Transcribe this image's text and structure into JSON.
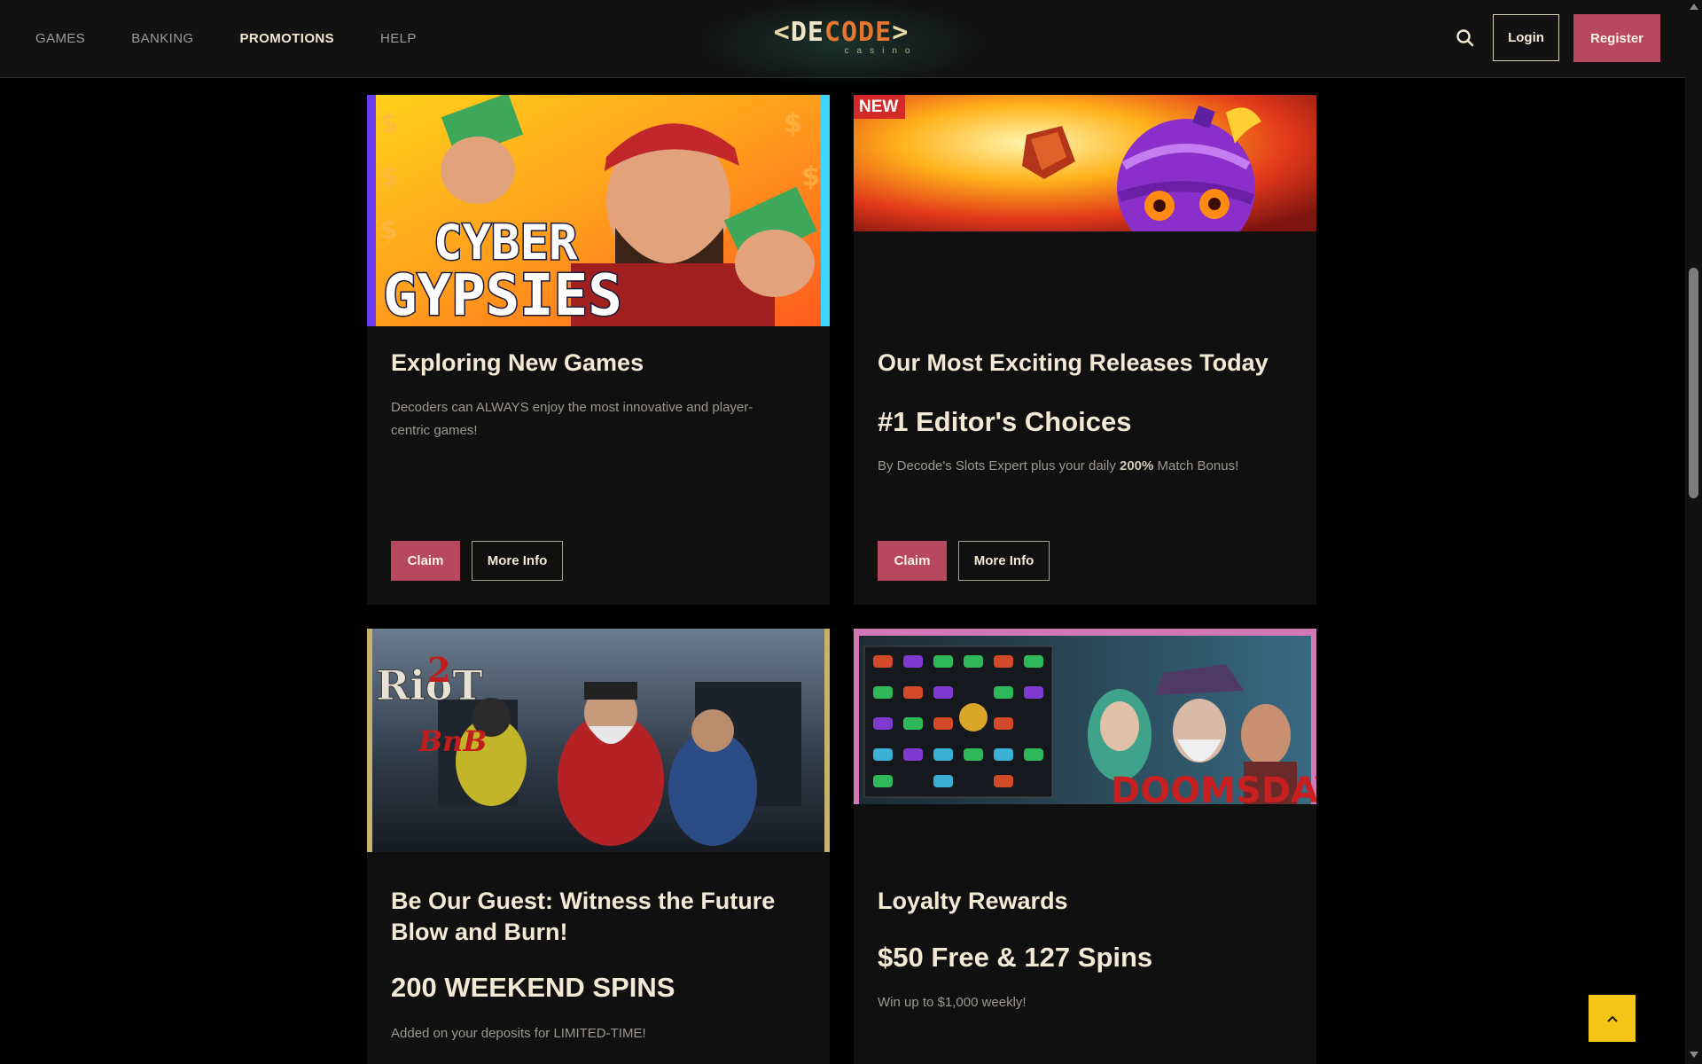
{
  "nav": {
    "items": [
      {
        "label": "GAMES",
        "active": false
      },
      {
        "label": "BANKING",
        "active": false
      },
      {
        "label": "PROMOTIONS",
        "active": true
      },
      {
        "label": "HELP",
        "active": false
      }
    ]
  },
  "logo": {
    "main": "DECODE",
    "sub": "casino"
  },
  "header": {
    "search_icon": "search-icon",
    "login_label": "Login",
    "register_label": "Register"
  },
  "cards": [
    {
      "image_text": "CYBER GYPSIES",
      "title": "Exploring New Games",
      "headline": "",
      "description": "Decoders can ALWAYS enjoy the most innovative and player-centric games!",
      "claim_label": "Claim",
      "more_label": "More Info"
    },
    {
      "badge": "NEW",
      "title": "Our Most Exciting Releases Today",
      "headline": "#1 Editor's Choices",
      "description_pre": "By Decode's Slots Expert plus your daily ",
      "description_bold": "200%",
      "description_post": " Match Bonus!",
      "claim_label": "Claim",
      "more_label": "More Info"
    },
    {
      "image_text": "Riot 2",
      "image_text_sub": "BnB",
      "title": "Be Our Guest: Witness the Future Blow and Burn!",
      "headline": "200 WEEKEND SPINS",
      "description": "Added on your deposits for LIMITED-TIME!"
    },
    {
      "image_text": "DOOMSDAY",
      "title": "Loyalty Rewards",
      "headline": "$50 Free & 127 Spins",
      "description": "Win up to $1,000 weekly!"
    }
  ],
  "colors": {
    "accent": "#b7485e",
    "background": "#000000",
    "card": "#101010",
    "back_to_top": "#f5c518"
  },
  "back_to_top_icon": "chevron-up-icon"
}
